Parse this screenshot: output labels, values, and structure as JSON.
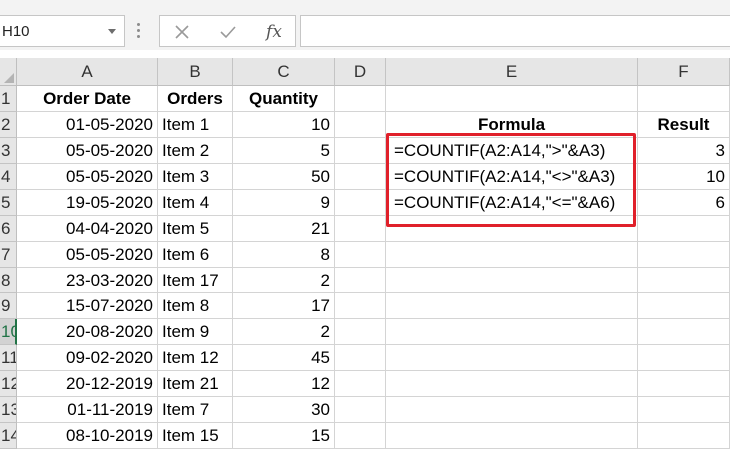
{
  "name_box": {
    "value": "H10"
  },
  "formula_bar": {
    "cancel_icon": "close-icon",
    "enter_icon": "checkmark-icon",
    "fx_label": "fx",
    "content": ""
  },
  "columns": [
    "A",
    "B",
    "C",
    "D",
    "E",
    "F"
  ],
  "rows": [
    "1",
    "2",
    "3",
    "4",
    "5",
    "6",
    "7",
    "8",
    "9",
    "10",
    "11",
    "12",
    "13",
    "14"
  ],
  "selected_row": "10",
  "headers": {
    "A1": "Order Date",
    "B1": "Orders",
    "C1": "Quantity",
    "E2": "Formula",
    "F2": "Result"
  },
  "data_rows": [
    {
      "date": "01-05-2020",
      "order": "Item 1",
      "qty": "10"
    },
    {
      "date": "05-05-2020",
      "order": "Item 2",
      "qty": "5"
    },
    {
      "date": "05-05-2020",
      "order": "Item 3",
      "qty": "50"
    },
    {
      "date": "19-05-2020",
      "order": "Item 4",
      "qty": "9"
    },
    {
      "date": "04-04-2020",
      "order": "Item 5",
      "qty": "21"
    },
    {
      "date": "05-05-2020",
      "order": "Item 6",
      "qty": "8"
    },
    {
      "date": "23-03-2020",
      "order": "Item 17",
      "qty": "2"
    },
    {
      "date": "15-07-2020",
      "order": "Item 8",
      "qty": "17"
    },
    {
      "date": "20-08-2020",
      "order": "Item 9",
      "qty": "2"
    },
    {
      "date": "09-02-2020",
      "order": "Item 12",
      "qty": "45"
    },
    {
      "date": "20-12-2019",
      "order": "Item 21",
      "qty": "12"
    },
    {
      "date": "01-11-2019",
      "order": "Item 7",
      "qty": "30"
    },
    {
      "date": "08-10-2019",
      "order": "Item 15",
      "qty": "15"
    }
  ],
  "formulas": [
    {
      "formula": "=COUNTIF(A2:A14,\">\"&A3)",
      "result": "3"
    },
    {
      "formula": "=COUNTIF(A2:A14,\"<>\"&A3)",
      "result": "10"
    },
    {
      "formula": "=COUNTIF(A2:A14,\"<=\"&A6)",
      "result": "6"
    }
  ],
  "colors": {
    "highlight_box": "#e0202a",
    "selection_accent": "#217346"
  }
}
